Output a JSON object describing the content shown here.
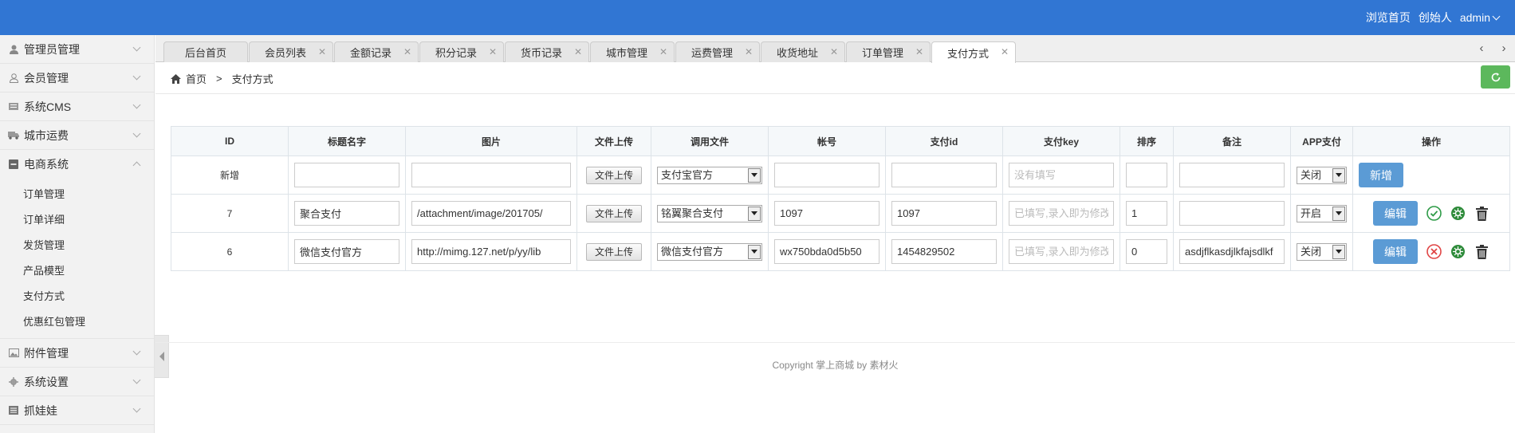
{
  "header": {
    "links": [
      "浏览首页",
      "创始人"
    ],
    "user": "admin",
    "bg_color": "#3176d3"
  },
  "sidebar": {
    "items": [
      {
        "label": "管理员管理",
        "icon": "user-icon"
      },
      {
        "label": "会员管理",
        "icon": "member-icon"
      },
      {
        "label": "系统CMS",
        "icon": "cms-icon"
      },
      {
        "label": "城市运费",
        "icon": "truck-icon"
      },
      {
        "label": "电商系统",
        "icon": "minus-square-icon",
        "expanded": true,
        "children": [
          "订单管理",
          "订单详细",
          "发货管理",
          "产品模型",
          "支付方式",
          "优惠红包管理"
        ]
      },
      {
        "label": "附件管理",
        "icon": "image-icon"
      },
      {
        "label": "系统设置",
        "icon": "gear-icon"
      },
      {
        "label": "抓娃娃",
        "icon": "list-icon"
      }
    ]
  },
  "tabs": [
    "后台首页",
    "会员列表",
    "金额记录",
    "积分记录",
    "货币记录",
    "城市管理",
    "运费管理",
    "收货地址",
    "订单管理",
    "支付方式"
  ],
  "active_tab": "支付方式",
  "breadcrumb": {
    "home": "首页",
    "sep": ">",
    "current": "支付方式"
  },
  "table": {
    "headers": [
      "ID",
      "标题名字",
      "图片",
      "文件上传",
      "调用文件",
      "帐号",
      "支付id",
      "支付key",
      "排序",
      "备注",
      "APP支付",
      "操作"
    ],
    "upload_label": "文件上传",
    "add_label": "新增",
    "edit_label": "编辑",
    "new_row": {
      "id": "新增",
      "title": "",
      "image": "",
      "file": "支付宝官方",
      "account": "",
      "pay_id": "",
      "key_placeholder": "没有填写",
      "sort": "",
      "remark": "",
      "app": "关闭"
    },
    "rows": [
      {
        "id": "7",
        "title": "聚合支付",
        "image": "/attachment/image/201705/",
        "file": "铭翼聚合支付",
        "account": "1097",
        "pay_id": "1097",
        "key_placeholder": "已填写,录入即为修改",
        "sort": "1",
        "remark": "",
        "app": "开启",
        "status": "enabled"
      },
      {
        "id": "6",
        "title": "微信支付官方",
        "image": "http://mimg.127.net/p/yy/lib",
        "file": "微信支付官方",
        "account": "wx750bda0d5b50",
        "pay_id": "1454829502",
        "key_placeholder": "已填写,录入即为修改",
        "sort": "0",
        "remark": "asdjflkasdjlkfajsdlkf",
        "app": "关闭",
        "status": "disabled"
      }
    ]
  },
  "footer": "Copyright 掌上商城 by 素材火",
  "colors": {
    "accent": "#3176d3",
    "button_blue": "#5b9bd5",
    "refresh_green": "#5cb85c",
    "ok_green": "#2e9b47",
    "cancel_red": "#e04545"
  }
}
